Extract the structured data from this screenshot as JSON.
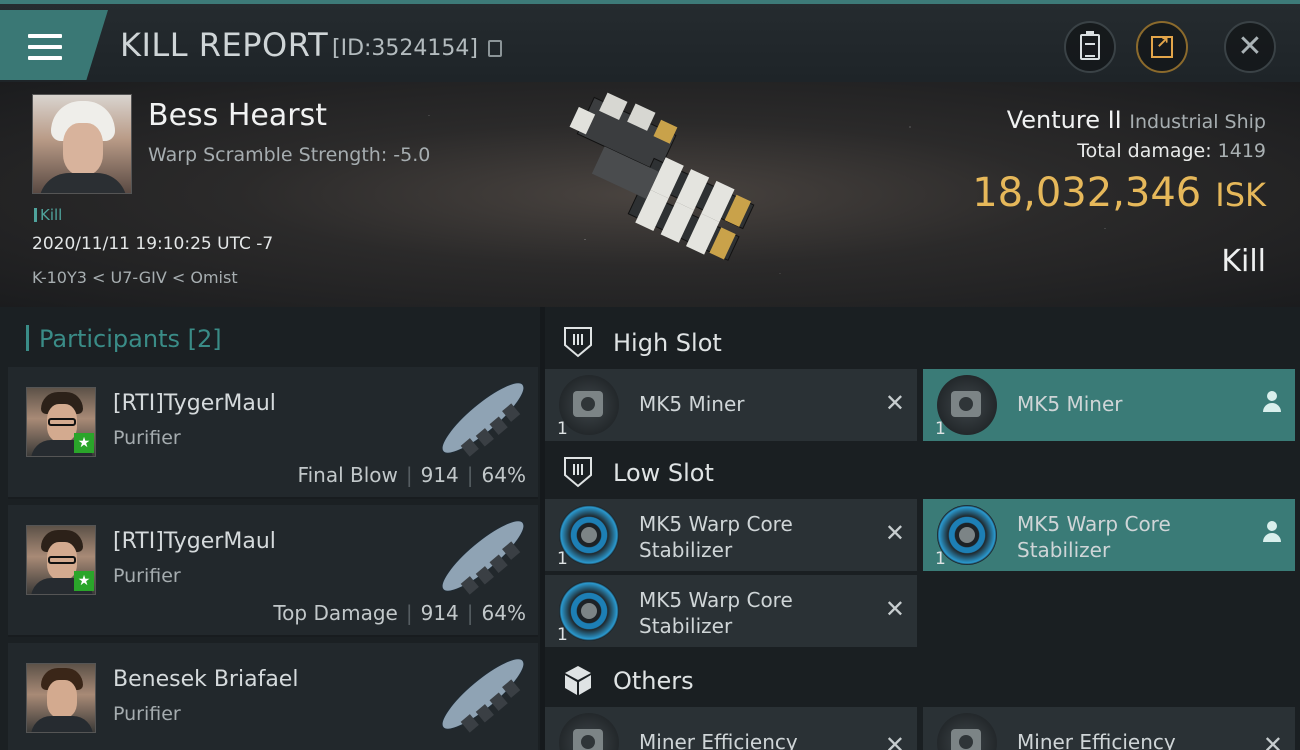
{
  "header": {
    "title": "KILL REPORT",
    "report_id": "[ID:3524154]"
  },
  "victim": {
    "name": "Bess Hearst",
    "warp_scramble": "Warp Scramble Strength: -5.0",
    "kill_tag": "Kill",
    "datetime": "2020/11/11 19:10:25 UTC -7",
    "location": "K-10Y3 < U7-GIV < Omist",
    "ship_name": "Venture II",
    "ship_class": "Industrial Ship",
    "total_damage_label": "Total damage:",
    "total_damage_value": "1419",
    "isk_value": "18,032,346",
    "isk_unit": "ISK",
    "result": "Kill"
  },
  "participants": {
    "header": "Participants [2]",
    "rows": [
      {
        "name": "[RTI]TygerMaul",
        "ship": "Purifier",
        "tag": "Final Blow",
        "damage": "914",
        "percent": "64%",
        "star": true
      },
      {
        "name": "[RTI]TygerMaul",
        "ship": "Purifier",
        "tag": "Top Damage",
        "damage": "914",
        "percent": "64%",
        "star": true
      },
      {
        "name": "Benesek Briafael",
        "ship": "Purifier",
        "tag": "",
        "damage": "",
        "percent": "",
        "star": false
      }
    ]
  },
  "fitting": {
    "high_slot": {
      "title": "High Slot",
      "modules": [
        {
          "name": "MK5 Miner",
          "qty": "1",
          "state": "destroyed"
        },
        {
          "name": "MK5 Miner",
          "qty": "1",
          "state": "dropped"
        }
      ]
    },
    "low_slot": {
      "title": "Low Slot",
      "modules": [
        {
          "name": "MK5 Warp Core Stabilizer",
          "qty": "1",
          "state": "destroyed"
        },
        {
          "name": "MK5 Warp Core Stabilizer",
          "qty": "1",
          "state": "dropped"
        },
        {
          "name": "MK5 Warp Core Stabilizer",
          "qty": "1",
          "state": "destroyed"
        }
      ]
    },
    "others": {
      "title": "Others",
      "modules": [
        {
          "name": "Miner Efficiency",
          "qty": "",
          "state": "destroyed"
        },
        {
          "name": "Miner Efficiency",
          "qty": "",
          "state": "destroyed"
        }
      ]
    }
  },
  "colors": {
    "accent": "#3a7875",
    "isk": "#e6b85a",
    "highlight_row": "#3a7b77"
  },
  "icons": [
    "menu-icon",
    "copy-icon",
    "clipboard-icon",
    "share-icon",
    "close-icon",
    "star-icon",
    "high-slot-icon",
    "low-slot-icon",
    "cube-icon",
    "remove-icon",
    "user-icon"
  ]
}
